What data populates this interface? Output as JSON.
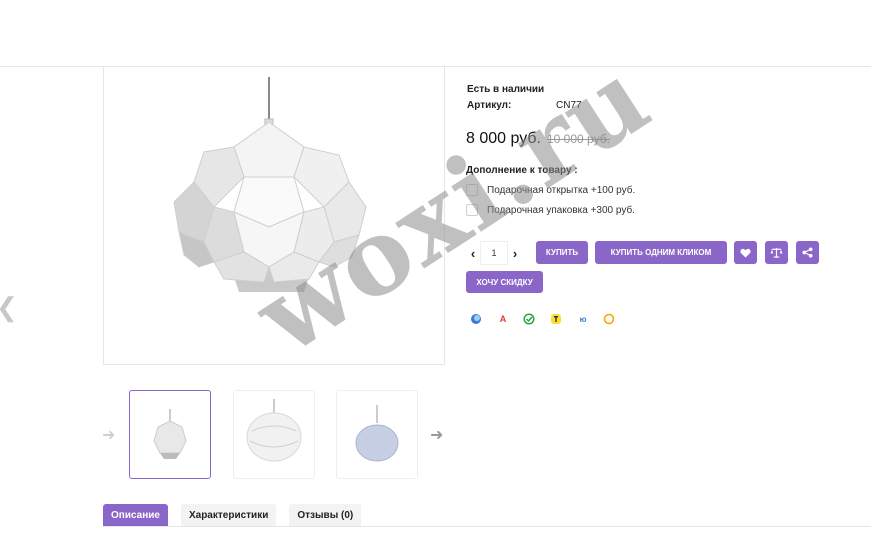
{
  "product": {
    "stock_status": "Есть в наличии",
    "sku_label": "Артикул:",
    "sku_value": "CN77",
    "price": "8 000 руб.",
    "old_price": "10 000 руб.",
    "addons_title": "Дополнение к товару :",
    "addons": [
      {
        "label": "Подарочная открытка +100 руб.",
        "checked": false
      },
      {
        "label": "Подарочная упаковка +300 руб.",
        "checked": false
      }
    ],
    "quantity": "1",
    "buy_label": "Купить",
    "one_click_label": "Купить одним кликом",
    "discount_label": "Хочу скидку"
  },
  "icons": {
    "favorite": "heart-icon",
    "compare": "scales-icon",
    "share": "share-icon"
  },
  "payment_icons": [
    "mir-icon",
    "alfa-icon",
    "sber-icon",
    "tinkoff-icon",
    "yumoney-icon",
    "qiwi-icon"
  ],
  "tabs": [
    {
      "label": "Описание",
      "active": true
    },
    {
      "label": "Характеристики",
      "active": false
    },
    {
      "label": "Отзывы (0)",
      "active": false
    }
  ],
  "watermark": "woxi.ru",
  "colors": {
    "accent": "#8b66c9",
    "border": "#e6e6e6",
    "old_price": "#999999"
  }
}
